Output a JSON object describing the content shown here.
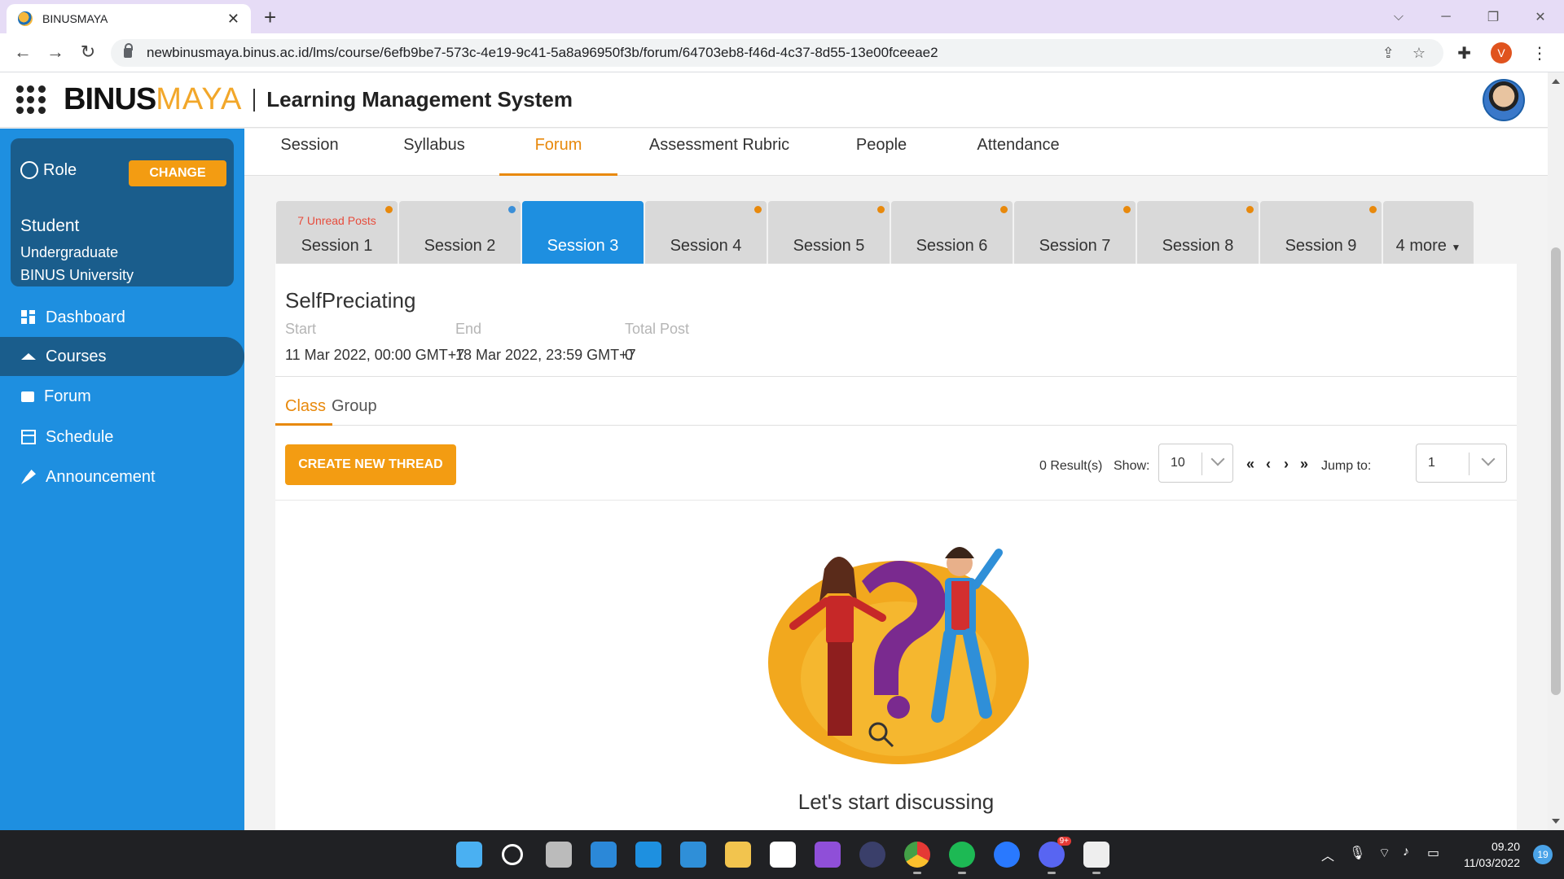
{
  "browser": {
    "tab_title": "BINUSMAYA",
    "tab_close": "✕",
    "new_tab": "+",
    "url": "newbinusmaya.binus.ac.id/lms/course/6efb9be7-573c-4e19-9c41-5a8a96950f3b/forum/64703eb8-f46d-4c37-8d55-13e00fceeae2",
    "profile_initial": "V"
  },
  "header": {
    "logo_main": "BINUS",
    "logo_accent": "MAYA",
    "system_title": "Learning Management System"
  },
  "sidebar": {
    "role_label": "Role",
    "change_button": "CHANGE",
    "role_name": "Student",
    "role_level": "Undergraduate",
    "role_org": "BINUS University",
    "items": [
      {
        "label": "Dashboard",
        "icon": "dashboard-icon"
      },
      {
        "label": "Courses",
        "icon": "graduation-cap-icon",
        "active": true
      },
      {
        "label": "Forum",
        "icon": "forum-icon"
      },
      {
        "label": "Schedule",
        "icon": "calendar-icon"
      },
      {
        "label": "Announcement",
        "icon": "megaphone-icon"
      }
    ]
  },
  "course_nav": {
    "tabs": [
      "Session",
      "Syllabus",
      "Forum",
      "Assessment Rubric",
      "People",
      "Attendance"
    ],
    "active": "Forum"
  },
  "sessions": {
    "tabs": [
      "Session 1",
      "Session 2",
      "Session 3",
      "Session 4",
      "Session 5",
      "Session 6",
      "Session 7",
      "Session 8",
      "Session 9"
    ],
    "unread_label": "7 Unread Posts",
    "active": "Session 3",
    "more_label": "4 more",
    "accent_color": "#e8890c",
    "active_color": "#1e8fe0"
  },
  "forum": {
    "title": "SelfPreciating",
    "start_label": "Start",
    "start_value": "11 Mar 2022, 00:00 GMT+7",
    "end_label": "End",
    "end_value": "18 Mar 2022, 23:59 GMT+7",
    "total_label": "Total Post",
    "total_value": "0",
    "subtabs": [
      "Class",
      "Group"
    ],
    "create_button": "CREATE NEW THREAD",
    "results": "0 Result(s)",
    "show_label": "Show:",
    "show_value": "10",
    "pager": {
      "first": "«",
      "prev": "‹",
      "next": "›",
      "last": "»"
    },
    "jump_label": "Jump to:",
    "jump_value": "1",
    "empty_message": "Let's start discussing"
  },
  "taskbar": {
    "time": "09.20",
    "date": "11/03/2022",
    "notification_count": "19",
    "chat_badge": "9+"
  }
}
